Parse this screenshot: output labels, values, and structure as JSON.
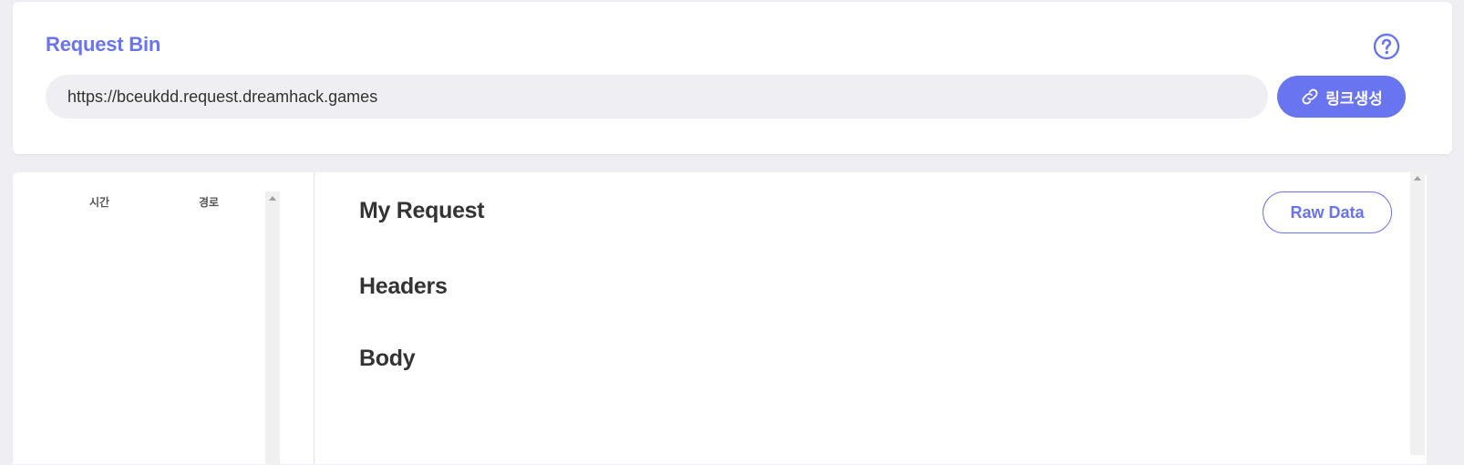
{
  "header": {
    "title": "Request Bin",
    "help_icon": "question-circle-icon",
    "url_value": "https://bceukdd.request.dreamhack.games",
    "generate_button_label": "링크생성",
    "generate_button_icon": "link-icon",
    "accent_color": "#6874f0"
  },
  "request_list": {
    "columns": [
      "시간",
      "경로"
    ]
  },
  "detail": {
    "title": "My Request",
    "raw_button_label": "Raw Data",
    "sections": [
      "Headers",
      "Body"
    ]
  }
}
